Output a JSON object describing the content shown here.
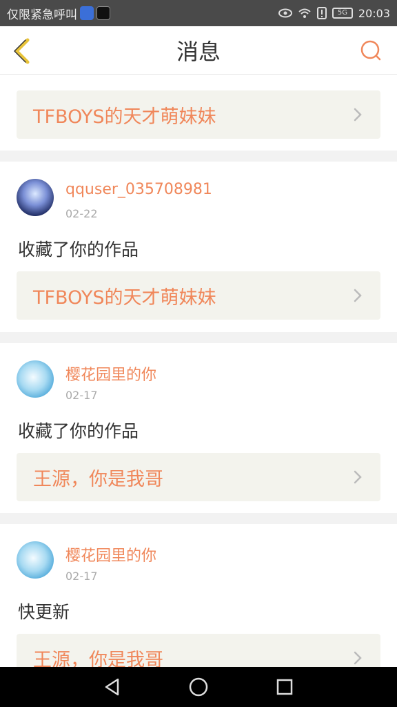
{
  "status_bar": {
    "notification_text": "仅限紧急呼叫",
    "network": "5G",
    "time": "20:03",
    "icons": [
      "baidu-app-icon",
      "tiktok-app-icon",
      "eye-icon",
      "wifi-icon",
      "alert-icon",
      "battery-icon"
    ]
  },
  "header": {
    "title": "消息",
    "back_icon": "chevron-left-icon",
    "search_icon": "search-icon"
  },
  "colors": {
    "accent": "#f0875a",
    "card_bg": "#f3f3ed",
    "divider": "#f2f2f2"
  },
  "partial_card": {
    "work_title": "TFBOYS的天才萌妹妹"
  },
  "messages": [
    {
      "username": "qquser_035708981",
      "date": "02-22",
      "text": "收藏了你的作品",
      "work_title": "TFBOYS的天才萌妹妹"
    },
    {
      "username": "樱花园里的你",
      "date": "02-17",
      "text": "收藏了你的作品",
      "work_title": "王源，你是我哥"
    },
    {
      "username": "樱花园里的你",
      "date": "02-17",
      "text": "快更新",
      "work_title": "王源，你是我哥"
    }
  ]
}
